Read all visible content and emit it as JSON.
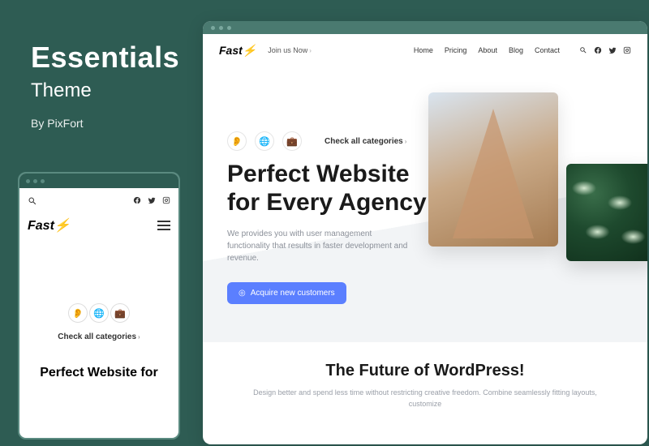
{
  "sidebar": {
    "title": "Essentials",
    "subtitle": "Theme",
    "byline": "By PixFort"
  },
  "brand": {
    "name": "Fast",
    "bolt": "⚡"
  },
  "mobile": {
    "check_categories": "Check all categories",
    "headline": "Perfect Website for"
  },
  "nav": {
    "join": "Join us Now",
    "items": [
      "Home",
      "Pricing",
      "About",
      "Blog",
      "Contact"
    ]
  },
  "hero": {
    "check_categories": "Check all categories",
    "headline_l1": "Perfect Website",
    "headline_l2": "for Every Agency",
    "sub": "We provides you with user management functionality that results in faster development and revenue.",
    "cta": "Acquire new customers"
  },
  "future": {
    "title": "The Future of WordPress!",
    "sub": "Design better and spend less time without restricting creative freedom. Combine seamlessly fitting layouts, customize"
  }
}
